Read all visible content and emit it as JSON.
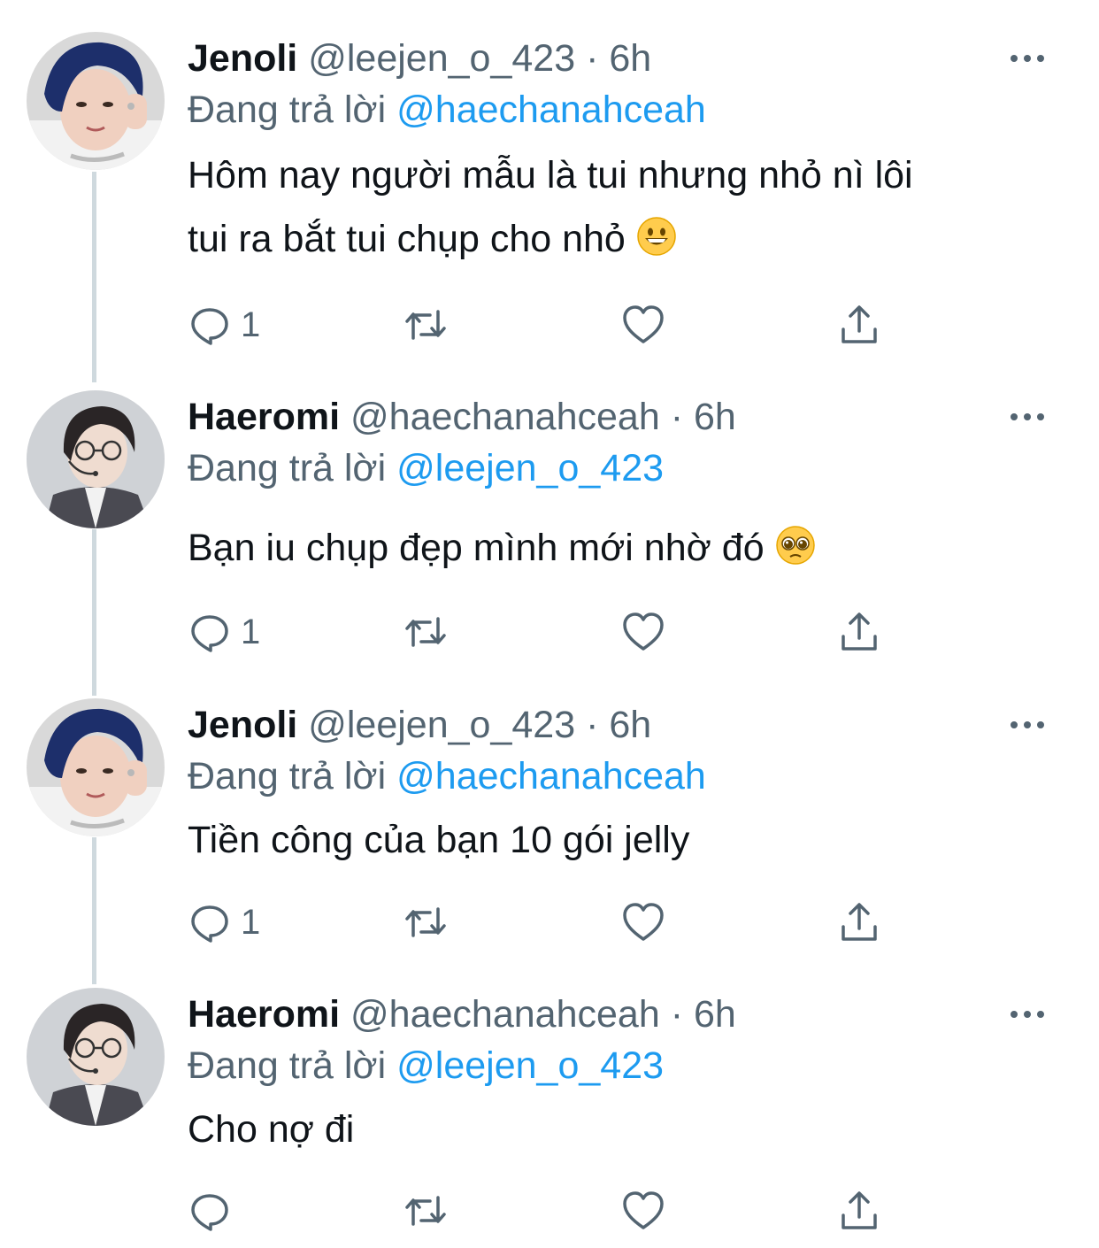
{
  "tweets": [
    {
      "display_name": "Jenoli",
      "handle": "@leejen_o_423",
      "time": "· 6h",
      "reply_prefix": "Đang trả lời",
      "reply_to": "@haechanahceah",
      "text_lines": [
        "Hôm nay người mẫu là tui nhưng nhỏ nì lôi",
        "tui ra bắt tui chụp cho nhỏ"
      ],
      "emoji": "grinning-face",
      "reply_count": "1",
      "avatar": "avatar-blue-hair"
    },
    {
      "display_name": "Haeromi",
      "handle": "@haechanahceah",
      "time": "· 6h",
      "reply_prefix": "Đang trả lời",
      "reply_to": "@leejen_o_423",
      "text_lines": [
        "Bạn iu chụp đẹp mình mới nhờ đó"
      ],
      "emoji": "pleading-face",
      "reply_count": "1",
      "avatar": "avatar-glasses-headset"
    },
    {
      "display_name": "Jenoli",
      "handle": "@leejen_o_423",
      "time": "· 6h",
      "reply_prefix": "Đang trả lời",
      "reply_to": "@haechanahceah",
      "text_lines": [
        "Tiền công của bạn 10 gói jelly"
      ],
      "emoji": "",
      "reply_count": "1",
      "avatar": "avatar-blue-hair"
    },
    {
      "display_name": "Haeromi",
      "handle": "@haechanahceah",
      "time": "· 6h",
      "reply_prefix": "Đang trả lời",
      "reply_to": "@leejen_o_423",
      "text_lines": [
        "Cho nợ đi"
      ],
      "emoji": "",
      "reply_count": "",
      "avatar": "avatar-glasses-headset"
    }
  ],
  "icons": {
    "reply": "reply-icon",
    "retweet": "retweet-icon",
    "like": "heart-icon",
    "share": "share-icon",
    "more": "more-icon"
  },
  "colors": {
    "text": "#0f1419",
    "secondary": "#536471",
    "mention": "#1d9bf0",
    "thread_line": "#cfd9de"
  }
}
